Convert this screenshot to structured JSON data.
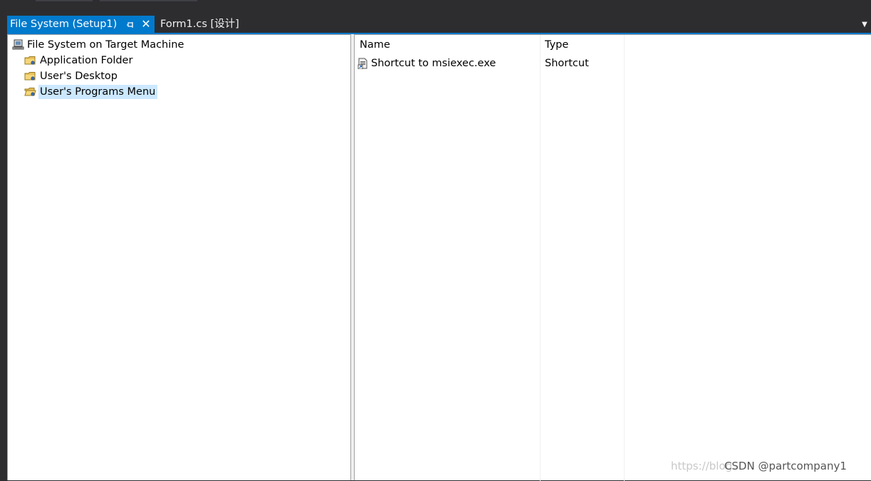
{
  "tabs": {
    "active": {
      "label": "File System (Setup1)",
      "pin_icon": "pin-icon",
      "close_icon": "close-icon"
    },
    "inactive": {
      "label": "Form1.cs [设计]"
    },
    "dropdown_icon": "chevron-down-icon"
  },
  "tree": {
    "root": {
      "label": "File System on Target Machine",
      "icon": "computer-icon"
    },
    "children": [
      {
        "label": "Application Folder",
        "icon": "folder-icon",
        "selected": false
      },
      {
        "label": "User's Desktop",
        "icon": "folder-icon",
        "selected": false
      },
      {
        "label": "User's Programs Menu",
        "icon": "folder-open-icon",
        "selected": true
      }
    ]
  },
  "list": {
    "columns": [
      "Name",
      "Type"
    ],
    "rows": [
      {
        "name": "Shortcut to msiexec.exe",
        "type": "Shortcut",
        "icon": "shortcut-icon"
      }
    ]
  },
  "watermark": {
    "url_text": "https://blog.",
    "brand": "CSDN @partcompany1"
  },
  "colors": {
    "accent": "#007acc",
    "chrome_background": "#2d2d30",
    "selection": "#cce8ff"
  }
}
